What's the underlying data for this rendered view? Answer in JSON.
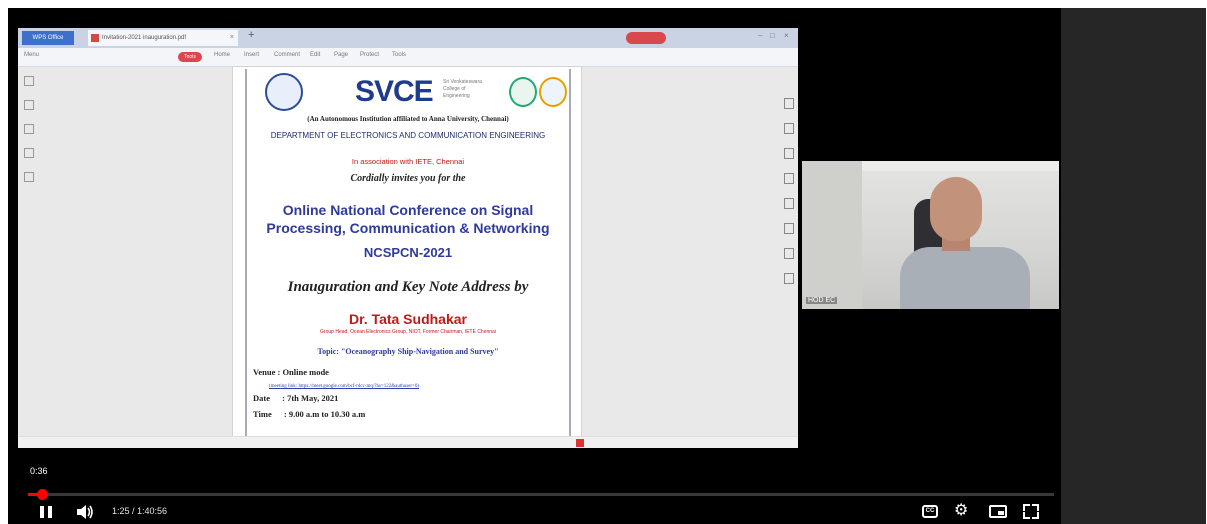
{
  "shared_screen": {
    "app_button": "WPS Office",
    "doc_tab_title": "Invitation-2021 inauguration.pdf",
    "ribbon": [
      "Menu",
      "Home",
      "Insert",
      "Comment",
      "Edit",
      "Page",
      "Protect",
      "Tools"
    ],
    "active_ribbon": "Tools",
    "poster": {
      "logo_text": "SVCE",
      "logo_sub": "Sri Venkateswara College of Engineering",
      "autonomous": "(An Autonomous Institution affiliated to Anna University, Chennai)",
      "department": "DEPARTMENT OF ELECTRONICS AND COMMUNICATION ENGINEERING",
      "association": "In association with IETE, Chennai",
      "invite": "Cordially invites you for the",
      "conference": "Online National Conference on Signal Processing, Communication & Networking",
      "code": "NCSPCN-2021",
      "inauguration": "Inauguration and Key Note Address by",
      "speaker": "Dr. Tata Sudhakar",
      "speaker_role": "Group Head, Ocean Electronics Group, NIOT, Former Chairman, IETE Chennai",
      "topic": "Topic: \"Oceanography Ship-Navigation and Survey\"",
      "venue_label": "Venue : Online mode",
      "meeting_link_label": "(meeting link: https://meet.google.com/bcf-rdcc-mq/?hs=122&authuser=0)",
      "date_label": "Date",
      "date_value": ": 7th May, 2021",
      "time_label": "Time",
      "time_value": ": 9.00 a.m to 10.30 a.m"
    }
  },
  "webcam": {
    "participant_label": "HOD EC"
  },
  "player": {
    "chapter_time": "0:36",
    "time_display": "1:25 / 1:40:56",
    "progress": 0.014,
    "cc_label": "CC",
    "accent_color": "#ff0000"
  }
}
